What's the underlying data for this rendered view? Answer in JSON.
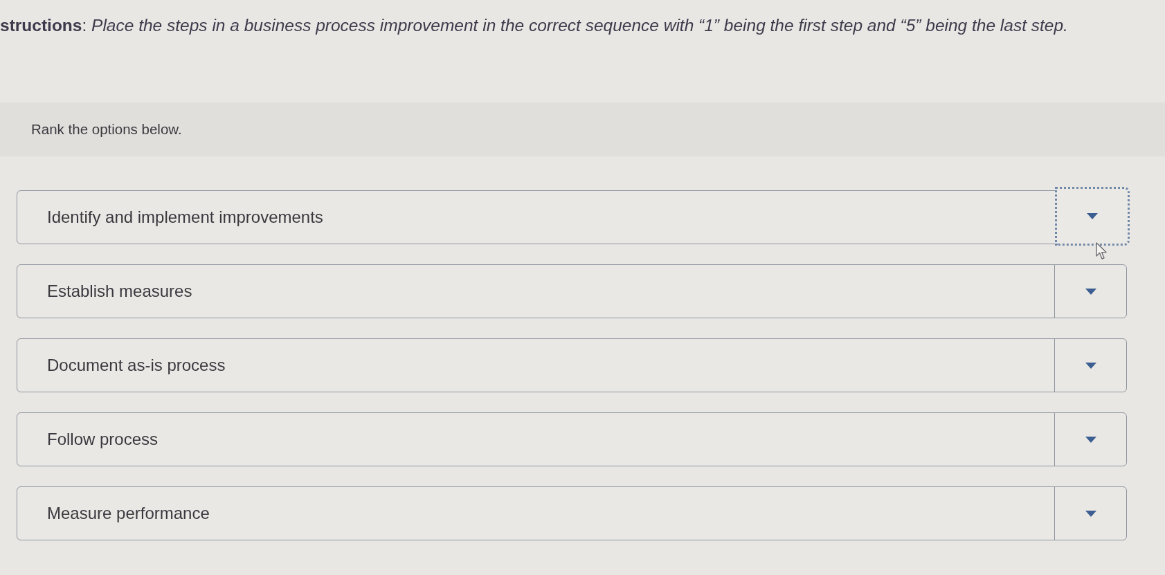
{
  "instructions": "**structions**: *Place the steps in a business process improvement in the correct sequence with “1” being the first step and “5” being the last step.*",
  "prompt": "Rank the options below.",
  "options": [
    {
      "label": "Identify and implement improvements",
      "focused": true
    },
    {
      "label": "Establish measures",
      "focused": false
    },
    {
      "label": "Document as-is process",
      "focused": false
    },
    {
      "label": "Follow process",
      "focused": false
    },
    {
      "label": "Measure performance",
      "focused": false
    }
  ]
}
